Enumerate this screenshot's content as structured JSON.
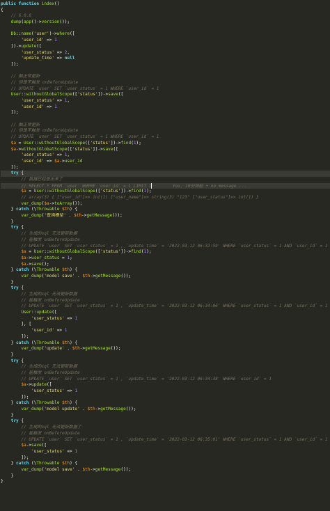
{
  "colors": {
    "background": "#272822",
    "keyword": "#66d9ef",
    "function": "#a6e22e",
    "string": "#e6db74",
    "number": "#ae81ff",
    "comment": "#75715e",
    "variable": "#fd971f",
    "operator": "#f92672",
    "plain": "#f8f8f2"
  },
  "lines": [
    {
      "seg": [
        [
          "kw",
          "public function "
        ],
        [
          "fn",
          "index"
        ],
        [
          "pl",
          "()"
        ]
      ]
    },
    {
      "seg": [
        [
          "pl",
          "{"
        ]
      ]
    },
    {
      "seg": [
        [
          "cm",
          "    // 6.0.8"
        ]
      ]
    },
    {
      "seg": [
        [
          "fn",
          "    dump"
        ],
        [
          "pl",
          "("
        ],
        [
          "fn",
          "app"
        ],
        [
          "pl",
          "()->"
        ],
        [
          "fn",
          "version"
        ],
        [
          "pl",
          "());"
        ]
      ]
    },
    {
      "seg": [
        [
          "pl",
          ""
        ]
      ]
    },
    {
      "seg": [
        [
          "cls",
          "    Db"
        ],
        [
          "pl",
          "::"
        ],
        [
          "fn",
          "name"
        ],
        [
          "pl",
          "("
        ],
        [
          "str",
          "'user'"
        ],
        [
          "pl",
          ")->"
        ],
        [
          "fn",
          "where"
        ],
        [
          "pl",
          "(["
        ]
      ]
    },
    {
      "seg": [
        [
          "str",
          "        'user_id'"
        ],
        [
          "pl",
          " => "
        ],
        [
          "num",
          "1"
        ]
      ]
    },
    {
      "seg": [
        [
          "pl",
          "    ])->"
        ],
        [
          "fn",
          "update"
        ],
        [
          "pl",
          "(["
        ]
      ]
    },
    {
      "seg": [
        [
          "str",
          "        'user_status'"
        ],
        [
          "pl",
          " => "
        ],
        [
          "num",
          "2"
        ],
        [
          "pl",
          ","
        ]
      ]
    },
    {
      "seg": [
        [
          "str",
          "        'update_time'"
        ],
        [
          "pl",
          " => "
        ],
        [
          "kw",
          "null"
        ]
      ]
    },
    {
      "seg": [
        [
          "pl",
          "    ]);"
        ]
      ]
    },
    {
      "seg": [
        [
          "pl",
          ""
        ]
      ]
    },
    {
      "seg": [
        [
          "cm",
          "    // 触正常更新"
        ]
      ]
    },
    {
      "seg": [
        [
          "cm",
          "    // 但是不触发 onBeforeUpdate"
        ]
      ]
    },
    {
      "seg": [
        [
          "cm",
          "    // UPDATE `user` SET `user_status` = 1 WHERE `user_id` = 1"
        ]
      ]
    },
    {
      "seg": [
        [
          "cls",
          "    User"
        ],
        [
          "pl",
          "::"
        ],
        [
          "fn",
          "withoutGlobalScope"
        ],
        [
          "pl",
          "(["
        ],
        [
          "str",
          "'status'"
        ],
        [
          "pl",
          "])->"
        ],
        [
          "fn",
          "save"
        ],
        [
          "pl",
          "(["
        ]
      ]
    },
    {
      "seg": [
        [
          "str",
          "        'user_status'"
        ],
        [
          "pl",
          " => "
        ],
        [
          "num",
          "1"
        ],
        [
          "pl",
          ","
        ]
      ]
    },
    {
      "seg": [
        [
          "str",
          "        'user_id'"
        ],
        [
          "pl",
          " => "
        ],
        [
          "num",
          "1"
        ]
      ]
    },
    {
      "seg": [
        [
          "pl",
          "    ]);"
        ]
      ]
    },
    {
      "seg": [
        [
          "pl",
          ""
        ]
      ]
    },
    {
      "seg": [
        [
          "cm",
          "    // 触正常更新"
        ]
      ]
    },
    {
      "seg": [
        [
          "cm",
          "    // 但是不触发 onBeforeUpdate"
        ]
      ]
    },
    {
      "seg": [
        [
          "cm",
          "    // UPDATE `user` SET `user_status` = 1 WHERE `user_id` = 1"
        ]
      ]
    },
    {
      "seg": [
        [
          "var",
          "    $a"
        ],
        [
          "pl",
          " = "
        ],
        [
          "cls",
          "User"
        ],
        [
          "pl",
          "::"
        ],
        [
          "fn",
          "withoutGlobalScope"
        ],
        [
          "pl",
          "(["
        ],
        [
          "str",
          "'status'"
        ],
        [
          "pl",
          "])->"
        ],
        [
          "fn",
          "find"
        ],
        [
          "pl",
          "("
        ],
        [
          "num",
          "1"
        ],
        [
          "pl",
          ");"
        ]
      ]
    },
    {
      "seg": [
        [
          "var",
          "    $a"
        ],
        [
          "pl",
          "->"
        ],
        [
          "fn",
          "withoutGlobalScope"
        ],
        [
          "pl",
          "(["
        ],
        [
          "str",
          "'status'"
        ],
        [
          "pl",
          "])->"
        ],
        [
          "fn",
          "save"
        ],
        [
          "pl",
          "(["
        ]
      ]
    },
    {
      "seg": [
        [
          "str",
          "        'user_status'"
        ],
        [
          "pl",
          " => "
        ],
        [
          "num",
          "1"
        ],
        [
          "pl",
          ","
        ]
      ]
    },
    {
      "seg": [
        [
          "str",
          "        'user_id'"
        ],
        [
          "pl",
          " => "
        ],
        [
          "var",
          "$a"
        ],
        [
          "pl",
          "->"
        ],
        [
          "fn",
          "user_id"
        ]
      ]
    },
    {
      "seg": [
        [
          "pl",
          "    ]);"
        ]
      ]
    },
    {
      "seg": [
        [
          "kw",
          "    try "
        ],
        [
          "pl",
          "{"
        ]
      ],
      "hl": true
    },
    {
      "seg": [
        [
          "cm",
          "        // 数据已经查出来了"
        ]
      ]
    },
    {
      "seg": [
        [
          "cm",
          "        // SELECT * FROM `user` WHERE `user_id` = 1 LIMIT 1"
        ],
        [
          "cursor",
          ""
        ],
        [
          "cm",
          "        You, 10分钟前 • no message ..."
        ]
      ],
      "hl": true
    },
    {
      "seg": [
        [
          "var",
          "        $a"
        ],
        [
          "pl",
          " = "
        ],
        [
          "cls",
          "User"
        ],
        [
          "pl",
          "::"
        ],
        [
          "fn",
          "withoutGlobalScope"
        ],
        [
          "pl",
          "(["
        ],
        [
          "str",
          "'status'"
        ],
        [
          "pl",
          "])->"
        ],
        [
          "fn",
          "find"
        ],
        [
          "pl",
          "("
        ],
        [
          "num",
          "1"
        ],
        [
          "pl",
          ");"
        ]
      ]
    },
    {
      "seg": [
        [
          "cm",
          "        // array(3) { [\"user_id\"]=> int(1) [\"user_name\"]=> string(3) \"123\" [\"user_status\"]=> int(1) }"
        ]
      ]
    },
    {
      "seg": [
        [
          "fn",
          "        var_dump"
        ],
        [
          "pl",
          "("
        ],
        [
          "var",
          "$a"
        ],
        [
          "pl",
          "->"
        ],
        [
          "fn",
          "toArray"
        ],
        [
          "pl",
          "());"
        ]
      ]
    },
    {
      "seg": [
        [
          "pl",
          "    } "
        ],
        [
          "kw",
          "catch "
        ],
        [
          "pl",
          "(\\"
        ],
        [
          "cls",
          "Throwable"
        ],
        [
          "var",
          " $th"
        ],
        [
          "pl",
          ") {"
        ]
      ]
    },
    {
      "seg": [
        [
          "fn",
          "        var_dump"
        ],
        [
          "pl",
          "("
        ],
        [
          "str",
          "'查询模型'"
        ],
        [
          "pl",
          " . "
        ],
        [
          "var",
          "$th"
        ],
        [
          "pl",
          "->"
        ],
        [
          "fn",
          "getMessage"
        ],
        [
          "pl",
          "());"
        ]
      ]
    },
    {
      "seg": [
        [
          "pl",
          "    }"
        ]
      ]
    },
    {
      "seg": [
        [
          "kw",
          "    try "
        ],
        [
          "pl",
          "{"
        ]
      ]
    },
    {
      "seg": [
        [
          "cm",
          "        // 生成的sql 无法更新数据"
        ]
      ]
    },
    {
      "seg": [
        [
          "cm",
          "        // 能触发 onBeforeUpdate"
        ]
      ]
    },
    {
      "seg": [
        [
          "cm",
          "        // UPDATE `user` SET `user_status` = 1 , `update_time` = '2022-03-12 06:32:59' WHERE `user_status` = 1 AND `user_id` = 1"
        ]
      ]
    },
    {
      "seg": [
        [
          "var",
          "        $a"
        ],
        [
          "pl",
          " = "
        ],
        [
          "cls",
          "User"
        ],
        [
          "pl",
          "::"
        ],
        [
          "fn",
          "withoutGlobalScope"
        ],
        [
          "pl",
          "(["
        ],
        [
          "str",
          "'status'"
        ],
        [
          "pl",
          "])->"
        ],
        [
          "fn",
          "find"
        ],
        [
          "pl",
          "("
        ],
        [
          "num",
          "1"
        ],
        [
          "pl",
          ");"
        ]
      ]
    },
    {
      "seg": [
        [
          "var",
          "        $a"
        ],
        [
          "pl",
          "->"
        ],
        [
          "fn",
          "user_status"
        ],
        [
          "pl",
          " = "
        ],
        [
          "num",
          "1"
        ],
        [
          "pl",
          ";"
        ]
      ]
    },
    {
      "seg": [
        [
          "var",
          "        $a"
        ],
        [
          "pl",
          "->"
        ],
        [
          "fn",
          "save"
        ],
        [
          "pl",
          "();"
        ]
      ]
    },
    {
      "seg": [
        [
          "pl",
          "    } "
        ],
        [
          "kw",
          "catch "
        ],
        [
          "pl",
          "(\\"
        ],
        [
          "cls",
          "Throwable"
        ],
        [
          "var",
          " $th"
        ],
        [
          "pl",
          ") {"
        ]
      ]
    },
    {
      "seg": [
        [
          "fn",
          "        var_dump"
        ],
        [
          "pl",
          "("
        ],
        [
          "str",
          "'model save'"
        ],
        [
          "pl",
          " . "
        ],
        [
          "var",
          "$th"
        ],
        [
          "pl",
          "->"
        ],
        [
          "fn",
          "getMessage"
        ],
        [
          "pl",
          "());"
        ]
      ]
    },
    {
      "seg": [
        [
          "pl",
          "    }"
        ]
      ]
    },
    {
      "seg": [
        [
          "kw",
          "    try "
        ],
        [
          "pl",
          "{"
        ]
      ]
    },
    {
      "seg": [
        [
          "cm",
          "        // 生成的sql 无法更新数据"
        ]
      ]
    },
    {
      "seg": [
        [
          "cm",
          "        // 能触发 onBeforeUpdate"
        ]
      ]
    },
    {
      "seg": [
        [
          "cm",
          "        // UPDATE `user` SET `user_status` = 1 , `update_time` = '2022-03-12 06:34:06' WHERE `user_status` = 1 AND `user_id` = 1"
        ]
      ]
    },
    {
      "seg": [
        [
          "cls",
          "        User"
        ],
        [
          "pl",
          "::"
        ],
        [
          "fn",
          "update"
        ],
        [
          "pl",
          "(["
        ]
      ]
    },
    {
      "seg": [
        [
          "str",
          "            'user_status'"
        ],
        [
          "pl",
          " => "
        ],
        [
          "num",
          "1"
        ]
      ]
    },
    {
      "seg": [
        [
          "pl",
          "        ], ["
        ]
      ]
    },
    {
      "seg": [
        [
          "str",
          "            'user_id'"
        ],
        [
          "pl",
          " => "
        ],
        [
          "num",
          "1"
        ]
      ]
    },
    {
      "seg": [
        [
          "pl",
          "        ]);"
        ]
      ]
    },
    {
      "seg": [
        [
          "pl",
          "    } "
        ],
        [
          "kw",
          "catch "
        ],
        [
          "pl",
          "(\\"
        ],
        [
          "cls",
          "Throwable"
        ],
        [
          "var",
          " $th"
        ],
        [
          "pl",
          ") {"
        ]
      ]
    },
    {
      "seg": [
        [
          "fn",
          "        var_dump"
        ],
        [
          "pl",
          "("
        ],
        [
          "str",
          "'update'"
        ],
        [
          "pl",
          " . "
        ],
        [
          "var",
          "$th"
        ],
        [
          "pl",
          "->"
        ],
        [
          "fn",
          "getMessage"
        ],
        [
          "pl",
          "());"
        ]
      ]
    },
    {
      "seg": [
        [
          "pl",
          "    }"
        ]
      ]
    },
    {
      "seg": [
        [
          "kw",
          "    try "
        ],
        [
          "pl",
          "{"
        ]
      ]
    },
    {
      "seg": [
        [
          "cm",
          "        // 生成的sql 无法更新数据"
        ]
      ]
    },
    {
      "seg": [
        [
          "cm",
          "        // 能触发 onBeforeUpdate"
        ]
      ]
    },
    {
      "seg": [
        [
          "cm",
          "        // UPDATE `user` SET `user_status` = 1 , `update_time` = '2022-03-12 06:34:38' WHERE `user_id` = 1"
        ]
      ]
    },
    {
      "seg": [
        [
          "var",
          "        $a"
        ],
        [
          "pl",
          "->"
        ],
        [
          "fn",
          "update"
        ],
        [
          "pl",
          "(["
        ]
      ]
    },
    {
      "seg": [
        [
          "str",
          "            'user_status'"
        ],
        [
          "pl",
          " => "
        ],
        [
          "num",
          "1"
        ]
      ]
    },
    {
      "seg": [
        [
          "pl",
          "        ]);"
        ]
      ]
    },
    {
      "seg": [
        [
          "pl",
          "    } "
        ],
        [
          "kw",
          "catch "
        ],
        [
          "pl",
          "(\\"
        ],
        [
          "cls",
          "Throwable"
        ],
        [
          "var",
          " $th"
        ],
        [
          "pl",
          ") {"
        ]
      ]
    },
    {
      "seg": [
        [
          "fn",
          "        var_dump"
        ],
        [
          "pl",
          "("
        ],
        [
          "str",
          "'model update'"
        ],
        [
          "pl",
          " . "
        ],
        [
          "var",
          "$th"
        ],
        [
          "pl",
          "->"
        ],
        [
          "fn",
          "getMessage"
        ],
        [
          "pl",
          "());"
        ]
      ]
    },
    {
      "seg": [
        [
          "pl",
          "    }"
        ]
      ]
    },
    {
      "seg": [
        [
          "kw",
          "    try "
        ],
        [
          "pl",
          "{"
        ]
      ]
    },
    {
      "seg": [
        [
          "cm",
          "        // 生成的sql 无法更新数据了"
        ]
      ]
    },
    {
      "seg": [
        [
          "cm",
          "        // 能触发 onBeforeUpdate"
        ]
      ]
    },
    {
      "seg": [
        [
          "cm",
          "        // UPDATE `user` SET `user_status` = 1 , `update_time` = '2022-03-12 06:35:01' WHERE `user_status` = 1 AND `user_id` = 1"
        ]
      ]
    },
    {
      "seg": [
        [
          "var",
          "        $a"
        ],
        [
          "pl",
          "->"
        ],
        [
          "fn",
          "save"
        ],
        [
          "pl",
          "(["
        ]
      ]
    },
    {
      "seg": [
        [
          "str",
          "            'user_status'"
        ],
        [
          "pl",
          " => "
        ],
        [
          "num",
          "1"
        ]
      ]
    },
    {
      "seg": [
        [
          "pl",
          "        ]);"
        ]
      ]
    },
    {
      "seg": [
        [
          "pl",
          "    } "
        ],
        [
          "kw",
          "catch "
        ],
        [
          "pl",
          "(\\"
        ],
        [
          "cls",
          "Throwable"
        ],
        [
          "var",
          " $th"
        ],
        [
          "pl",
          ") {"
        ]
      ]
    },
    {
      "seg": [
        [
          "fn",
          "        var_dump"
        ],
        [
          "pl",
          "("
        ],
        [
          "str",
          "'model save'"
        ],
        [
          "pl",
          " . "
        ],
        [
          "var",
          "$th"
        ],
        [
          "pl",
          "->"
        ],
        [
          "fn",
          "getMessage"
        ],
        [
          "pl",
          "());"
        ]
      ]
    },
    {
      "seg": [
        [
          "pl",
          "    }"
        ]
      ]
    },
    {
      "seg": [
        [
          "pl",
          "}"
        ]
      ]
    }
  ]
}
